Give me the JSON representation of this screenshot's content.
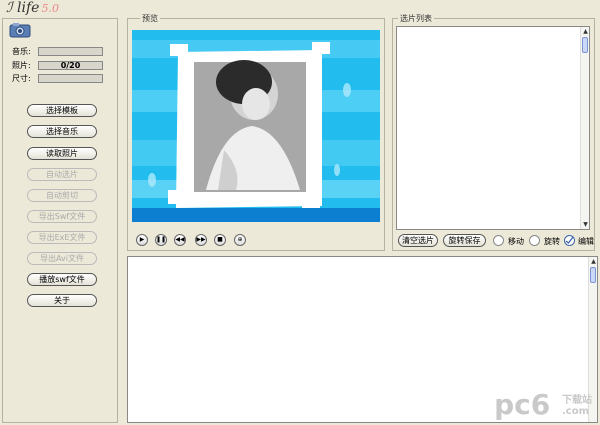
{
  "app": {
    "logo_text": "ℐ life",
    "logo_version": "5.0"
  },
  "info": {
    "music_label": "音乐:",
    "music_value": "",
    "photo_label": "照片:",
    "photo_value": "0/20",
    "size_label": "尺寸:",
    "size_value": ""
  },
  "buttons": [
    {
      "label": "选择模板",
      "enabled": true
    },
    {
      "label": "选择音乐",
      "enabled": true
    },
    {
      "label": "读取照片",
      "enabled": true
    },
    {
      "label": "自动选片",
      "enabled": false
    },
    {
      "label": "自动剪切",
      "enabled": false
    },
    {
      "label": "导出Swf文件",
      "enabled": false
    },
    {
      "label": "导出ExE文件",
      "enabled": false
    },
    {
      "label": "导出Avi文件",
      "enabled": false
    },
    {
      "label": "播放swf文件",
      "enabled": true
    },
    {
      "label": "关于",
      "enabled": true
    }
  ],
  "preview": {
    "group_label": "预览"
  },
  "playback": [
    "▶",
    "❚❚",
    "◀◀",
    "▶▶",
    "■",
    "⊕"
  ],
  "photo_list": {
    "group_label": "选片列表"
  },
  "list_actions": {
    "clear_label": "清空选片",
    "rotate_save_label": "旋转保存",
    "move_label": "移动",
    "rotate_label": "旋转",
    "edit_label": "编辑"
  },
  "watermark": "pc6",
  "watermark_site": "下载站",
  "watermark_com": ".com"
}
